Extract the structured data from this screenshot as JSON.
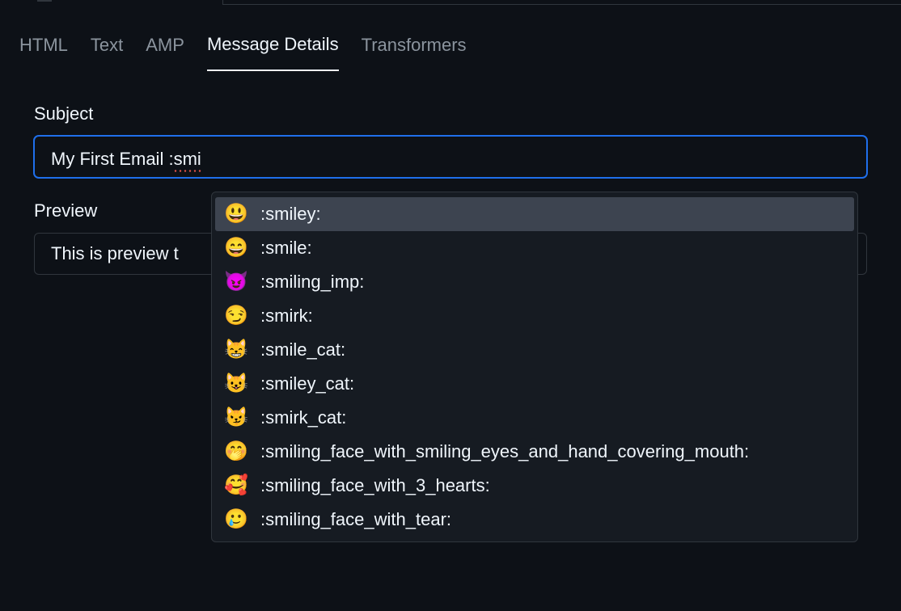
{
  "tabs": [
    {
      "label": "HTML",
      "active": false
    },
    {
      "label": "Text",
      "active": false
    },
    {
      "label": "AMP",
      "active": false
    },
    {
      "label": "Message Details",
      "active": true
    },
    {
      "label": "Transformers",
      "active": false
    }
  ],
  "fields": {
    "subject_label": "Subject",
    "subject_value_prefix": "My First Email :",
    "subject_value_typed": "smi",
    "preview_label": "Preview",
    "preview_value": "This is preview t"
  },
  "emoji_suggestions": [
    {
      "glyph": "😃",
      "code": ":smiley:",
      "highlighted": true
    },
    {
      "glyph": "😄",
      "code": ":smile:",
      "highlighted": false
    },
    {
      "glyph": "😈",
      "code": ":smiling_imp:",
      "highlighted": false
    },
    {
      "glyph": "😏",
      "code": ":smirk:",
      "highlighted": false
    },
    {
      "glyph": "😸",
      "code": ":smile_cat:",
      "highlighted": false
    },
    {
      "glyph": "😺",
      "code": ":smiley_cat:",
      "highlighted": false
    },
    {
      "glyph": "😼",
      "code": ":smirk_cat:",
      "highlighted": false
    },
    {
      "glyph": "🤭",
      "code": ":smiling_face_with_smiling_eyes_and_hand_covering_mouth:",
      "highlighted": false
    },
    {
      "glyph": "🥰",
      "code": ":smiling_face_with_3_hearts:",
      "highlighted": false
    },
    {
      "glyph": "🥲",
      "code": ":smiling_face_with_tear:",
      "highlighted": false
    }
  ]
}
